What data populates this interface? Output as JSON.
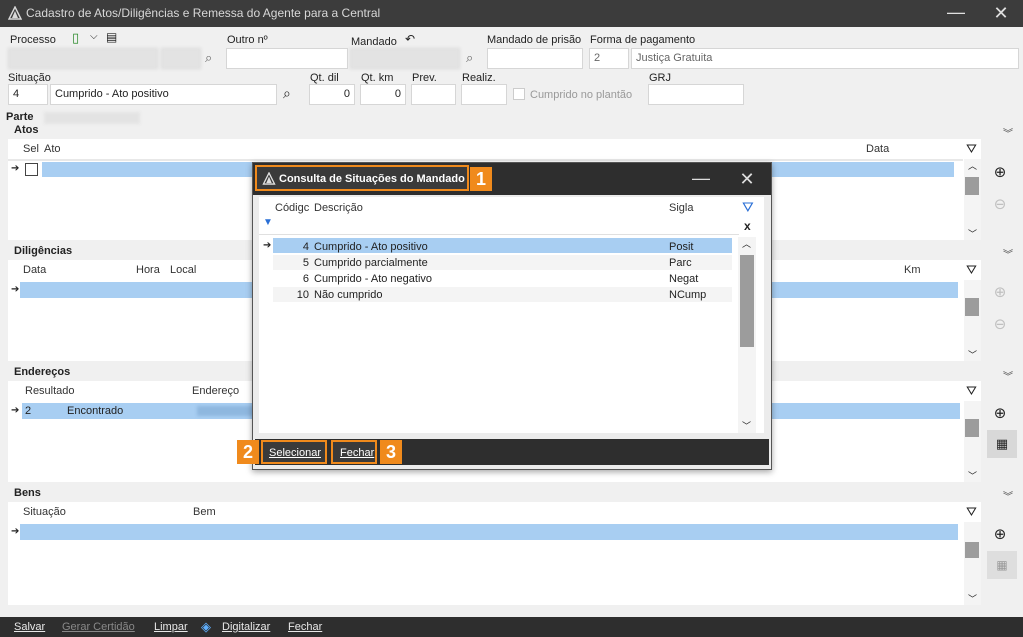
{
  "window": {
    "title": "Cadastro de Atos/Diligências e Remessa do Agente para a Central",
    "minimize": "—",
    "close": "✕"
  },
  "form": {
    "processo_label": "Processo",
    "outro_label": "Outro nº",
    "mandado_label": "Mandado",
    "mandado_prisao_label": "Mandado de prisão",
    "forma_pagamento_label": "Forma de pagamento",
    "forma_pagamento_code": "2",
    "forma_pagamento_value": "Justiça Gratuita",
    "situacao_label": "Situação",
    "situacao_code": "4",
    "situacao_value": "Cumprido - Ato positivo",
    "qt_dil_label": "Qt. dil",
    "qt_dil_value": "0",
    "qt_km_label": "Qt. km",
    "qt_km_value": "0",
    "prev_label": "Prev.",
    "realiz_label": "Realiz.",
    "cumprido_plantao_label": "Cumprido no plantão",
    "grj_label": "GRJ",
    "parte_label": "Parte"
  },
  "atos": {
    "title": "Atos",
    "headers": {
      "sel": "Sel",
      "ato": "Ato",
      "data": "Data"
    }
  },
  "diligencias": {
    "title": "Diligências",
    "headers": {
      "data": "Data",
      "hora": "Hora",
      "local": "Local",
      "km": "Km"
    }
  },
  "enderecos": {
    "title": "Endereços",
    "headers": {
      "resultado": "Resultado",
      "endereco": "Endereço"
    },
    "row": {
      "num": "2",
      "resultado": "Encontrado"
    }
  },
  "bens": {
    "title": "Bens",
    "headers": {
      "situacao": "Situação",
      "bem": "Bem"
    }
  },
  "dialog": {
    "title": "Consulta de Situações do Mandado",
    "headers": {
      "codigo": "Códigc",
      "descricao": "Descrição",
      "sigla": "Sigla"
    },
    "rows": [
      {
        "codigo": "4",
        "descricao": "Cumprido - Ato positivo",
        "sigla": "Posit"
      },
      {
        "codigo": "5",
        "descricao": "Cumprido parcialmente",
        "sigla": "Parc"
      },
      {
        "codigo": "6",
        "descricao": "Cumprido - Ato negativo",
        "sigla": "Negat"
      },
      {
        "codigo": "10",
        "descricao": "Não cumprido",
        "sigla": "NCump"
      }
    ],
    "selecionar": "Selecionar",
    "fechar": "Fechar",
    "clear": "x"
  },
  "callouts": {
    "one": "1",
    "two": "2",
    "three": "3"
  },
  "bottom": {
    "salvar": "Salvar",
    "gerar_certidao": "Gerar Certidão",
    "limpar": "Limpar",
    "digitalizar": "Digitalizar",
    "fechar": "Fechar"
  },
  "colors": {
    "accent": "#f08a1c",
    "selection": "#a8cef2",
    "titlebar": "#3c3c3c"
  }
}
